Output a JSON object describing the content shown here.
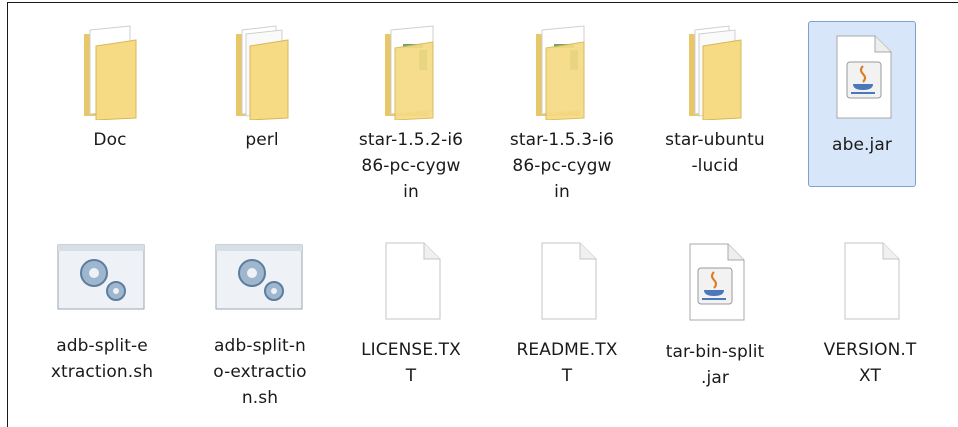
{
  "items": [
    {
      "label": "Doc",
      "icon": "folder-icon"
    },
    {
      "label": "perl",
      "icon": "folder-icon"
    },
    {
      "label": "star-1.5.2-i6\n86-pc-cygw\nin",
      "icon": "folder-icon"
    },
    {
      "label": "star-1.5.3-i6\n86-pc-cygw\nin",
      "icon": "folder-icon"
    },
    {
      "label": "star-ubuntu\n-lucid",
      "icon": "folder-icon"
    },
    {
      "label": "abe.jar",
      "icon": "java-jar-icon",
      "selected": true
    },
    {
      "label": "adb-split-e\nxtraction.sh",
      "icon": "script-gears-icon"
    },
    {
      "label": "adb-split-n\no-extractio\nn.sh",
      "icon": "script-gears-icon"
    },
    {
      "label": "LICENSE.TX\nT",
      "icon": "text-file-icon"
    },
    {
      "label": "README.TX\nT",
      "icon": "text-file-icon"
    },
    {
      "label": "tar-bin-split\n.jar",
      "icon": "java-jar-icon"
    },
    {
      "label": "VERSION.T\nXT",
      "icon": "text-file-icon"
    }
  ],
  "colors": {
    "selection": "#d8e6f9",
    "selection_border": "#7da2ce",
    "folder": "#f2d377"
  }
}
